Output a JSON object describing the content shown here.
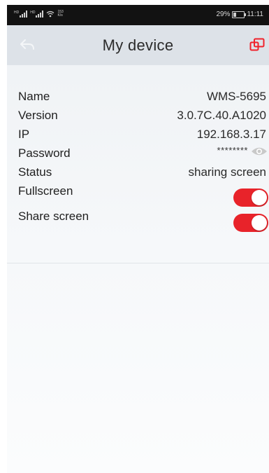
{
  "status_bar": {
    "hd1": "HD",
    "hd2": "HD",
    "speed_value": "153",
    "speed_unit": "K/s",
    "battery": "29%",
    "battery_level": 0.29,
    "time": "11:11"
  },
  "header": {
    "title": "My device",
    "back_icon": "back-arrow-icon",
    "right_icon": "cast-screen-icon",
    "accent_color": "#e8232a"
  },
  "device": {
    "rows": [
      {
        "label": "Name",
        "value": "WMS-5695"
      },
      {
        "label": "Version",
        "value": "3.0.7C.40.A1020"
      },
      {
        "label": "IP",
        "value": "192.168.3.17"
      },
      {
        "label": "Password",
        "value": "********"
      },
      {
        "label": "Status",
        "value": "sharing screen"
      }
    ],
    "toggles": [
      {
        "label": "Fullscreen",
        "on": true
      },
      {
        "label": "Share screen",
        "on": true
      }
    ]
  }
}
